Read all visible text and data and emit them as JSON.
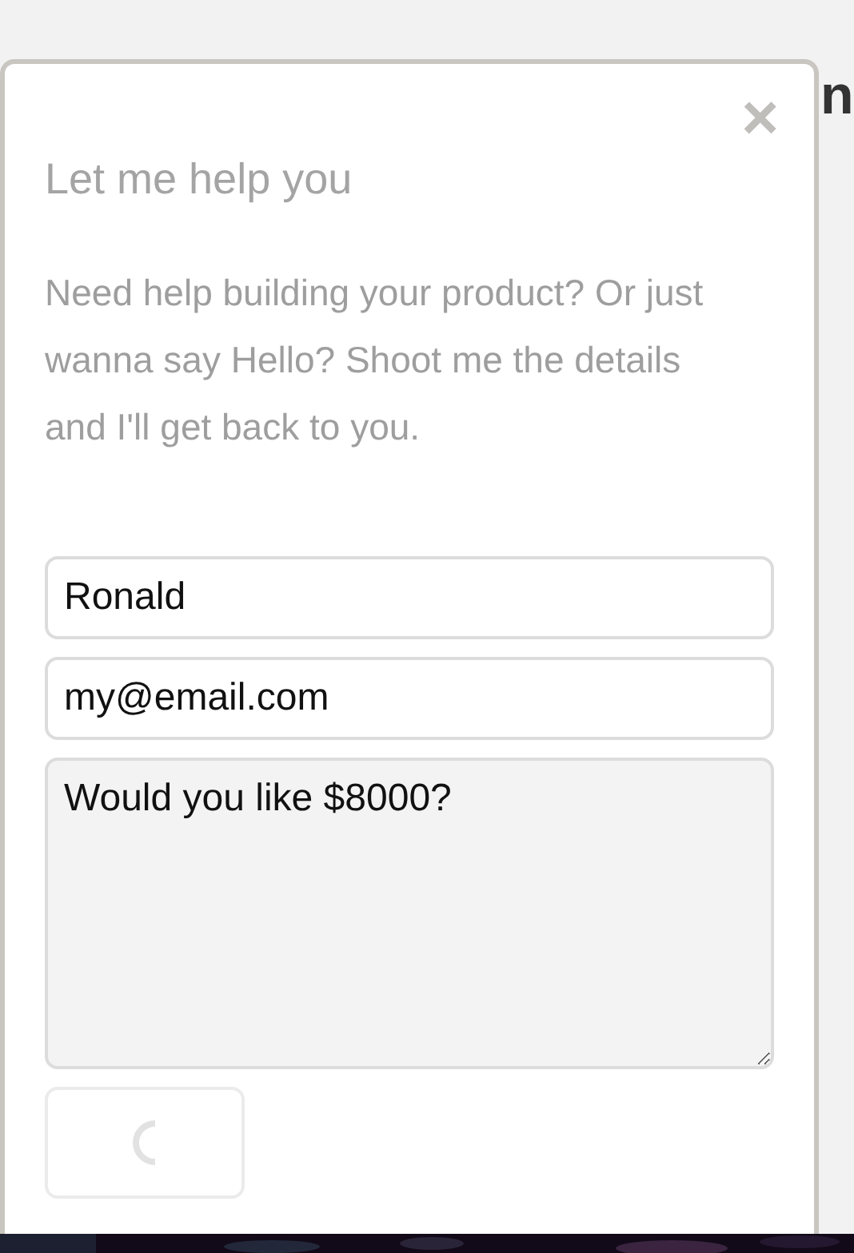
{
  "background_heading": {
    "text": "n"
  },
  "dialog": {
    "close": "×",
    "title": "Let me help you",
    "intro": "Need help building your product? Or just wanna say Hello? Shoot me the details and I'll get back to you.",
    "fields": [
      {
        "kind": "input",
        "value": "Ronald"
      },
      {
        "kind": "input",
        "value": "my@email.com"
      },
      {
        "kind": "textarea",
        "value": "Would you like $8000?"
      }
    ]
  }
}
